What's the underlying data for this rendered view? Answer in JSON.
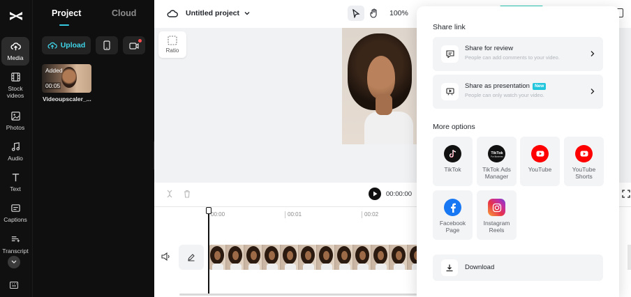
{
  "sidebar": {
    "items": [
      {
        "label": "Media",
        "icon": "cloud-upload-icon",
        "active": true
      },
      {
        "label": "Stock videos",
        "icon": "film-icon"
      },
      {
        "label": "Photos",
        "icon": "image-icon"
      },
      {
        "label": "Audio",
        "icon": "music-note-icon"
      },
      {
        "label": "Text",
        "icon": "text-icon"
      },
      {
        "label": "Captions",
        "icon": "captions-icon"
      },
      {
        "label": "Transcript",
        "icon": "transcript-icon"
      }
    ]
  },
  "media_panel": {
    "tabs": [
      "Project",
      "Cloud"
    ],
    "active_tab": "Project",
    "upload_label": "Upload",
    "asset": {
      "badge": "Added",
      "duration": "00:05",
      "name": "Videoupscaler_..."
    }
  },
  "topbar": {
    "project_title": "Untitled project",
    "zoom": "100%"
  },
  "canvas": {
    "ratio_label": "Ratio"
  },
  "timeline": {
    "current_time": "00:00:00",
    "ruler": [
      "00:00",
      "00:01",
      "00:02"
    ]
  },
  "share": {
    "link_heading": "Share link",
    "review": {
      "title": "Share for review",
      "subtitle": "People can add comments to your video."
    },
    "presentation": {
      "title": "Share as presentation",
      "badge": "New",
      "subtitle": "People can only watch your video."
    },
    "more_heading": "More options",
    "options": [
      {
        "label": "TikTok",
        "icon": "tiktok-icon"
      },
      {
        "label": "TikTok Ads Manager",
        "icon": "tiktok-business-icon"
      },
      {
        "label": "YouTube",
        "icon": "youtube-icon"
      },
      {
        "label": "YouTube Shorts",
        "icon": "youtube-shorts-icon"
      },
      {
        "label": "Facebook Page",
        "icon": "facebook-icon"
      },
      {
        "label": "Instagram Reels",
        "icon": "instagram-icon"
      }
    ],
    "download_label": "Download"
  },
  "colors": {
    "accent": "#35c9e1",
    "rail_bg": "#101010",
    "panel_bg": "#0f0f0f",
    "youtube_red": "#ff0000",
    "facebook_blue": "#1877f2",
    "new_badge": "#22c6dc"
  }
}
